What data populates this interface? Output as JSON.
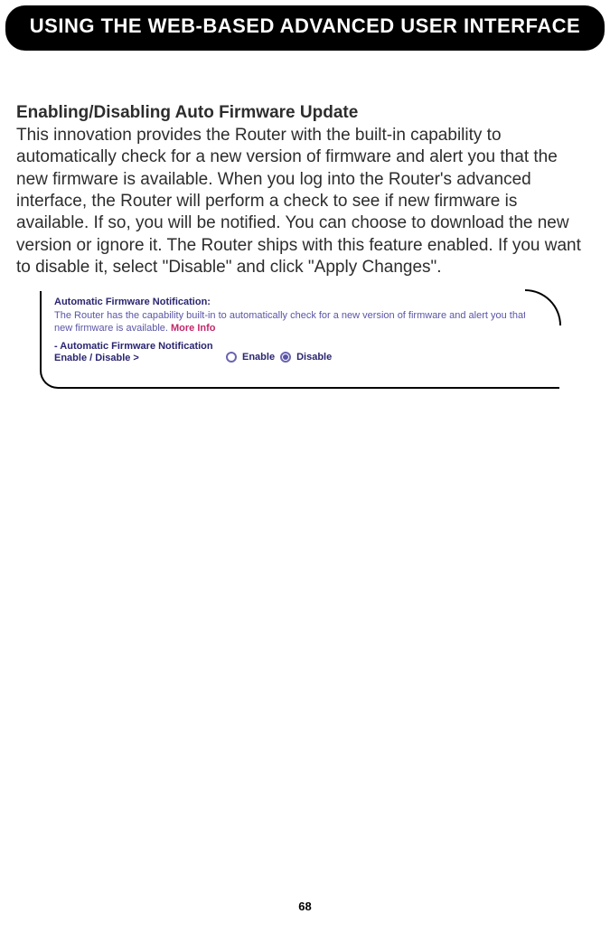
{
  "header": {
    "title": "USING THE WEB-BASED ADVANCED USER INTERFACE"
  },
  "section": {
    "title": "Enabling/Disabling Auto Firmware Update",
    "body": "This innovation provides the Router with the built-in capability to automatically check for a new version of firmware and alert you that the new firmware is available. When you log into the Router's advanced interface, the Router will perform a check to see if new firmware is available. If so, you will be notified. You can choose to download the new version or ignore it. The Router ships with this feature enabled. If you want to disable it, select \"Disable\" and click \"Apply Changes\"."
  },
  "panel": {
    "title": "Automatic Firmware Notification:",
    "desc": "The Router has the capability built-in to automatically check for a new version of firmware and alert you that the new firmware is available. ",
    "more_info": "More Info",
    "left_label": "- Automatic Firmware Notification Enable / Disable >",
    "enable_label": "Enable",
    "disable_label": "Disable",
    "selected": "disable"
  },
  "page_number": "68"
}
